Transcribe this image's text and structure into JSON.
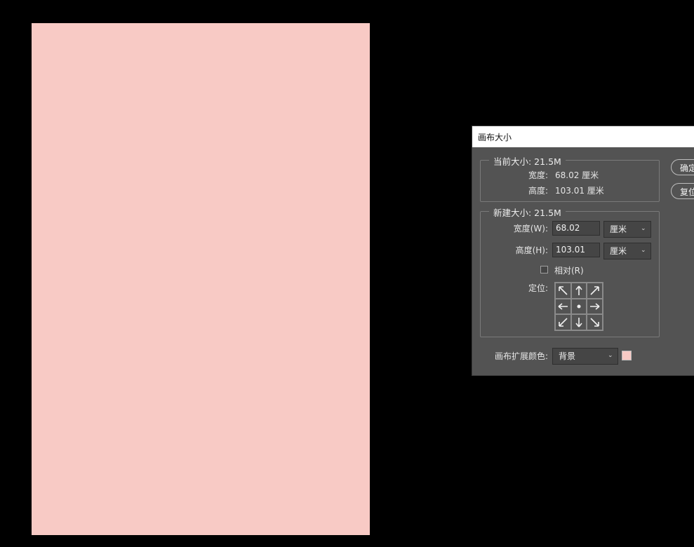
{
  "document": {
    "fill_color": "#f8cac5"
  },
  "dialog": {
    "title": "画布大小",
    "current_size": {
      "legend": "当前大小: 21.5M",
      "width_label": "宽度:",
      "width_value": "68.02 厘米",
      "height_label": "高度:",
      "height_value": "103.01 厘米"
    },
    "new_size": {
      "legend": "新建大小: 21.5M",
      "width_label": "宽度(W):",
      "width_value": "68.02",
      "width_unit": "厘米",
      "height_label": "高度(H):",
      "height_value": "103.01",
      "height_unit": "厘米",
      "relative_label": "相对(R)",
      "relative_checked": false,
      "anchor_label": "定位:"
    },
    "extension_color": {
      "label": "画布扩展颜色:",
      "value": "背景",
      "swatch_color": "#f8cac5"
    },
    "buttons": {
      "ok": "确定",
      "reset": "复位"
    }
  }
}
